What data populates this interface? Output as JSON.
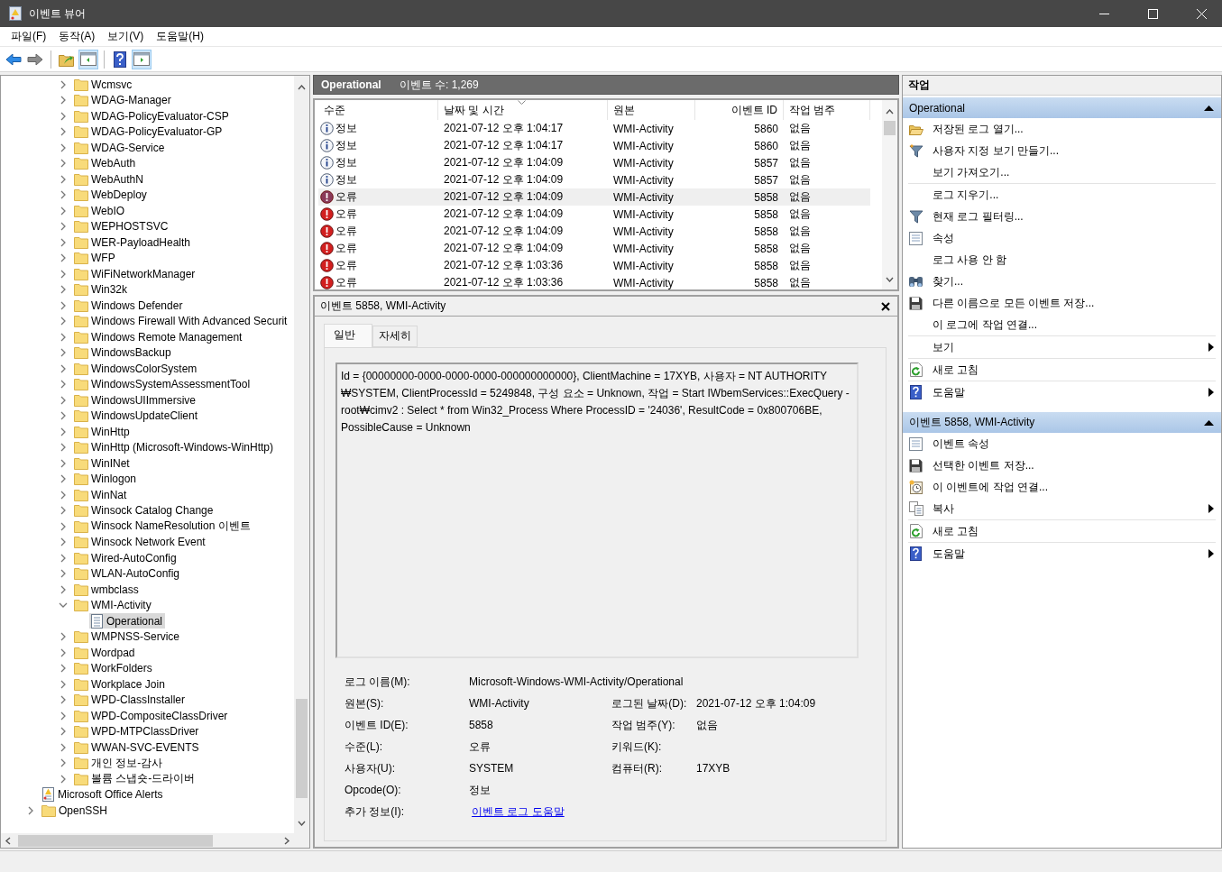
{
  "window": {
    "title": "이벤트 뷰어"
  },
  "menu": [
    "파일(F)",
    "동작(A)",
    "보기(V)",
    "도움말(H)"
  ],
  "toolbar": {
    "show_tree": {
      "on": true
    },
    "show_actions": {
      "on": true
    }
  },
  "tree": {
    "nodes": [
      {
        "kind": "offscreen",
        "children": [
          {
            "kind": "offscreen",
            "children": [
              {
                "kind": "folder",
                "label": "Wcmsvc",
                "expanded": false,
                "selected": false
              },
              {
                "kind": "folder",
                "label": "WDAG-Manager",
                "expanded": false,
                "selected": false
              },
              {
                "kind": "folder",
                "label": "WDAG-PolicyEvaluator-CSP",
                "expanded": false,
                "selected": false
              },
              {
                "kind": "folder",
                "label": "WDAG-PolicyEvaluator-GP",
                "expanded": false,
                "selected": false
              },
              {
                "kind": "folder",
                "label": "WDAG-Service",
                "expanded": false,
                "selected": false
              },
              {
                "kind": "folder",
                "label": "WebAuth",
                "expanded": false,
                "selected": false
              },
              {
                "kind": "folder",
                "label": "WebAuthN",
                "expanded": false,
                "selected": false
              },
              {
                "kind": "folder",
                "label": "WebDeploy",
                "expanded": false,
                "selected": false
              },
              {
                "kind": "folder",
                "label": "WebIO",
                "expanded": false,
                "selected": false
              },
              {
                "kind": "folder",
                "label": "WEPHOSTSVC",
                "expanded": false,
                "selected": false
              },
              {
                "kind": "folder",
                "label": "WER-PayloadHealth",
                "expanded": false,
                "selected": false
              },
              {
                "kind": "folder",
                "label": "WFP",
                "expanded": false,
                "selected": false
              },
              {
                "kind": "folder",
                "label": "WiFiNetworkManager",
                "expanded": false,
                "selected": false
              },
              {
                "kind": "folder",
                "label": "Win32k",
                "expanded": false,
                "selected": false
              },
              {
                "kind": "folder",
                "label": "Windows Defender",
                "expanded": false,
                "selected": false
              },
              {
                "kind": "folder",
                "label": "Windows Firewall With Advanced Securit",
                "expanded": false,
                "selected": false
              },
              {
                "kind": "folder",
                "label": "Windows Remote Management",
                "expanded": false,
                "selected": false
              },
              {
                "kind": "folder",
                "label": "WindowsBackup",
                "expanded": false,
                "selected": false
              },
              {
                "kind": "folder",
                "label": "WindowsColorSystem",
                "expanded": false,
                "selected": false
              },
              {
                "kind": "folder",
                "label": "WindowsSystemAssessmentTool",
                "expanded": false,
                "selected": false
              },
              {
                "kind": "folder",
                "label": "WindowsUIImmersive",
                "expanded": false,
                "selected": false
              },
              {
                "kind": "folder",
                "label": "WindowsUpdateClient",
                "expanded": false,
                "selected": false
              },
              {
                "kind": "folder",
                "label": "WinHttp",
                "expanded": false,
                "selected": false
              },
              {
                "kind": "folder",
                "label": "WinHttp (Microsoft-Windows-WinHttp)",
                "expanded": false,
                "selected": false
              },
              {
                "kind": "folder",
                "label": "WinINet",
                "expanded": false,
                "selected": false
              },
              {
                "kind": "folder",
                "label": "Winlogon",
                "expanded": false,
                "selected": false
              },
              {
                "kind": "folder",
                "label": "WinNat",
                "expanded": false,
                "selected": false
              },
              {
                "kind": "folder",
                "label": "Winsock Catalog Change",
                "expanded": false,
                "selected": false
              },
              {
                "kind": "folder",
                "label": "Winsock NameResolution 이벤트",
                "expanded": false,
                "selected": false
              },
              {
                "kind": "folder",
                "label": "Winsock Network Event",
                "expanded": false,
                "selected": false
              },
              {
                "kind": "folder",
                "label": "Wired-AutoConfig",
                "expanded": false,
                "selected": false
              },
              {
                "kind": "folder",
                "label": "WLAN-AutoConfig",
                "expanded": false,
                "selected": false
              },
              {
                "kind": "folder",
                "label": "wmbclass",
                "expanded": false,
                "selected": false
              },
              {
                "kind": "folder",
                "label": "WMI-Activity",
                "expanded": true,
                "selected": false,
                "children": [
                  {
                    "kind": "log",
                    "label": "Operational",
                    "selected": true
                  }
                ]
              },
              {
                "kind": "folder",
                "label": "WMPNSS-Service",
                "expanded": false,
                "selected": false
              },
              {
                "kind": "folder",
                "label": "Wordpad",
                "expanded": false,
                "selected": false
              },
              {
                "kind": "folder",
                "label": "WorkFolders",
                "expanded": false,
                "selected": false
              },
              {
                "kind": "folder",
                "label": "Workplace Join",
                "expanded": false,
                "selected": false
              },
              {
                "kind": "folder",
                "label": "WPD-ClassInstaller",
                "expanded": false,
                "selected": false
              },
              {
                "kind": "folder",
                "label": "WPD-CompositeClassDriver",
                "expanded": false,
                "selected": false
              },
              {
                "kind": "folder",
                "label": "WPD-MTPClassDriver",
                "expanded": false,
                "selected": false
              },
              {
                "kind": "folder",
                "label": "WWAN-SVC-EVENTS",
                "expanded": false,
                "selected": false
              },
              {
                "kind": "folder",
                "label": "개인 정보-감사",
                "expanded": false,
                "selected": false
              },
              {
                "kind": "folder",
                "label": "볼륨 스냅숏-드라이버",
                "expanded": false,
                "selected": false
              }
            ]
          }
        ]
      },
      {
        "kind": "log",
        "label": "Microsoft Office Alerts",
        "selected": false
      },
      {
        "kind": "folder",
        "label": "OpenSSH",
        "expanded": false,
        "selected": false
      }
    ]
  },
  "log_header": {
    "title": "Operational",
    "count": "이벤트 수: 1,269"
  },
  "events": {
    "columns": [
      {
        "label": "수준",
        "sorted": false
      },
      {
        "label": "날짜 및 시간",
        "sorted": true
      },
      {
        "label": "원본",
        "sorted": false
      },
      {
        "label": "이벤트 ID",
        "sorted": false
      },
      {
        "label": "작업 범주",
        "sorted": false
      }
    ],
    "rows": [
      {
        "kind": "info",
        "level": "정보",
        "date": "2021-07-12 오후 1:04:17",
        "source": "WMI-Activity",
        "event_id": "5860",
        "category": "없음",
        "selected": false
      },
      {
        "kind": "info",
        "level": "정보",
        "date": "2021-07-12 오후 1:04:17",
        "source": "WMI-Activity",
        "event_id": "5860",
        "category": "없음",
        "selected": false
      },
      {
        "kind": "info",
        "level": "정보",
        "date": "2021-07-12 오후 1:04:09",
        "source": "WMI-Activity",
        "event_id": "5857",
        "category": "없음",
        "selected": false
      },
      {
        "kind": "info",
        "level": "정보",
        "date": "2021-07-12 오후 1:04:09",
        "source": "WMI-Activity",
        "event_id": "5857",
        "category": "없음",
        "selected": false
      },
      {
        "kind": "error",
        "level": "오류",
        "date": "2021-07-12 오후 1:04:09",
        "source": "WMI-Activity",
        "event_id": "5858",
        "category": "없음",
        "selected": true
      },
      {
        "kind": "error",
        "level": "오류",
        "date": "2021-07-12 오후 1:04:09",
        "source": "WMI-Activity",
        "event_id": "5858",
        "category": "없음",
        "selected": false
      },
      {
        "kind": "error",
        "level": "오류",
        "date": "2021-07-12 오후 1:04:09",
        "source": "WMI-Activity",
        "event_id": "5858",
        "category": "없음",
        "selected": false
      },
      {
        "kind": "error",
        "level": "오류",
        "date": "2021-07-12 오후 1:04:09",
        "source": "WMI-Activity",
        "event_id": "5858",
        "category": "없음",
        "selected": false
      },
      {
        "kind": "error",
        "level": "오류",
        "date": "2021-07-12 오후 1:03:36",
        "source": "WMI-Activity",
        "event_id": "5858",
        "category": "없음",
        "selected": false
      },
      {
        "kind": "error",
        "level": "오류",
        "date": "2021-07-12 오후 1:03:36",
        "source": "WMI-Activity",
        "event_id": "5858",
        "category": "없음",
        "selected": false
      }
    ]
  },
  "detail": {
    "title": "이벤트 5858, WMI-Activity",
    "tabs": [
      {
        "label": "일반",
        "selected": true
      },
      {
        "label": "자세히",
        "selected": false
      }
    ],
    "description": "Id = {00000000-0000-0000-0000-000000000000}, ClientMachine = 17XYB, 사용자 = NT AUTHORITY ₩SYSTEM, ClientProcessId = 5249848, 구성 요소 = Unknown, 작업 = Start IWbemServices::ExecQuery - root₩cimv2 : Select * from Win32_Process Where ProcessID = '24036', ResultCode = 0x800706BE, PossibleCause = Unknown",
    "fields": [
      {
        "left": {
          "label": "로그 이름(M):",
          "value": "Microsoft-Windows-WMI-Activity/Operational"
        }
      },
      {
        "left": {
          "label": "원본(S):",
          "value": "WMI-Activity"
        },
        "right": {
          "label": "로그된 날짜(D):",
          "value": "2021-07-12 오후 1:04:09"
        }
      },
      {
        "left": {
          "label": "이벤트 ID(E):",
          "value": "5858"
        },
        "right": {
          "label": "작업 범주(Y):",
          "value": "없음"
        }
      },
      {
        "left": {
          "label": "수준(L):",
          "value": "오류"
        },
        "right": {
          "label": "키워드(K):"
        }
      },
      {
        "left": {
          "label": "사용자(U):",
          "value": "SYSTEM"
        },
        "right": {
          "label": "컴퓨터(R):",
          "value": "17XYB"
        }
      },
      {
        "left": {
          "label": "Opcode(O):",
          "value": "정보"
        }
      },
      {
        "left": {
          "label": "추가 정보(I):",
          "link": "이벤트 로그 도움말"
        }
      }
    ]
  },
  "actions": {
    "title": "작업",
    "sections": [
      {
        "title": "Operational",
        "expanded": true,
        "groups": [
          [
            {
              "label": "저장된 로그 열기...",
              "submenu": false
            },
            {
              "label": "사용자 지정 보기 만들기...",
              "submenu": false
            },
            {
              "label": "보기 가져오기...",
              "submenu": false
            }
          ],
          [
            {
              "label": "로그 지우기...",
              "submenu": false
            },
            {
              "label": "현재 로그 필터링...",
              "submenu": false
            },
            {
              "label": "속성",
              "submenu": false
            },
            {
              "label": "로그 사용 안 함",
              "submenu": false
            },
            {
              "label": "찾기...",
              "submenu": false
            },
            {
              "label": "다른 이름으로 모든 이벤트 저장...",
              "submenu": false
            },
            {
              "label": "이 로그에 작업 연결...",
              "submenu": false
            }
          ],
          [
            {
              "label": "보기",
              "submenu": true
            }
          ],
          [
            {
              "label": "새로 고침",
              "submenu": false
            }
          ],
          [
            {
              "label": "도움말",
              "submenu": true
            }
          ]
        ]
      },
      {
        "title": "이벤트 5858, WMI-Activity",
        "expanded": true,
        "groups": [
          [
            {
              "label": "이벤트 속성",
              "submenu": false
            },
            {
              "label": "선택한 이벤트 저장...",
              "submenu": false
            },
            {
              "label": "이 이벤트에 작업 연결...",
              "submenu": false
            },
            {
              "label": "복사",
              "submenu": true
            }
          ],
          [
            {
              "label": "새로 고침",
              "submenu": false
            }
          ],
          [
            {
              "label": "도움말",
              "submenu": true
            }
          ]
        ]
      }
    ]
  }
}
